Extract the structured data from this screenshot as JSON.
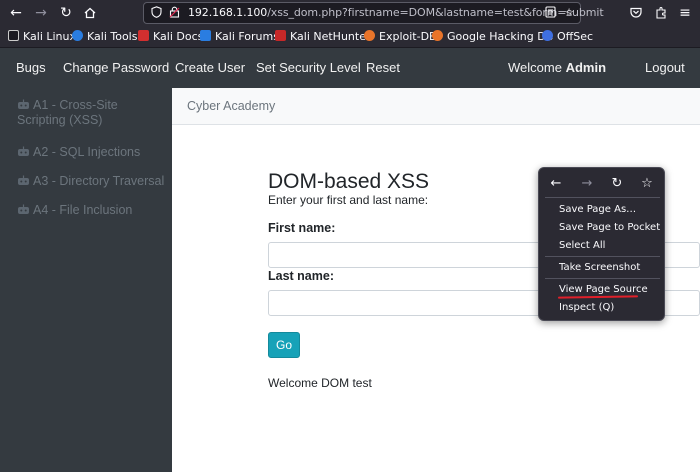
{
  "browser": {
    "url_host": "192.168.1.100",
    "url_path": "/xss_dom.php?firstname=DOM&lastname=test&form=submit",
    "icons": [
      "back-icon",
      "forward-icon",
      "reload-icon",
      "home-icon",
      "shield-icon",
      "lock-icon",
      "reader-icon",
      "bookmark-star-icon",
      "pocket-icon",
      "extensions-icon",
      "menu-icon"
    ]
  },
  "bookmarks": [
    {
      "label": "Kali Linux",
      "color": "#1c1b22"
    },
    {
      "label": "Kali Tools",
      "color": "#2a7de1"
    },
    {
      "label": "Kali Docs",
      "color": "#d32f2f"
    },
    {
      "label": "Kali Forums",
      "color": "#2a7de1"
    },
    {
      "label": "Kali NetHunter",
      "color": "#c62828"
    },
    {
      "label": "Exploit-DB",
      "color": "#e8742a"
    },
    {
      "label": "Google Hacking DB",
      "color": "#e8742a"
    },
    {
      "label": "OffSec",
      "color": "#3f6fe0"
    }
  ],
  "navbar": {
    "items": [
      "Bugs",
      "Change Password",
      "Create User",
      "Set Security Level",
      "Reset"
    ],
    "welcome_prefix": "Welcome",
    "welcome_user": "Admin",
    "logout": "Logout"
  },
  "sidebar": {
    "items": [
      "A1 - Cross-Site Scripting (XSS)",
      "A2 - SQL Injections",
      "A3 - Directory Traversal",
      "A4 - File Inclusion"
    ]
  },
  "main": {
    "breadcrumb": "Cyber Academy",
    "title": "DOM-based XSS",
    "subtitle": "Enter your first and last name:",
    "first_label": "First name:",
    "last_label": "Last name:",
    "go_label": "Go",
    "output": "Welcome DOM test"
  },
  "context_menu": {
    "items": [
      "Save Page As…",
      "Save Page to Pocket",
      "Select All",
      "Take Screenshot",
      "View Page Source",
      "Inspect (Q)"
    ]
  },
  "colors": {
    "navbar": "#343a40",
    "accent": "#17a2b8",
    "annotation": "#e0202a"
  }
}
